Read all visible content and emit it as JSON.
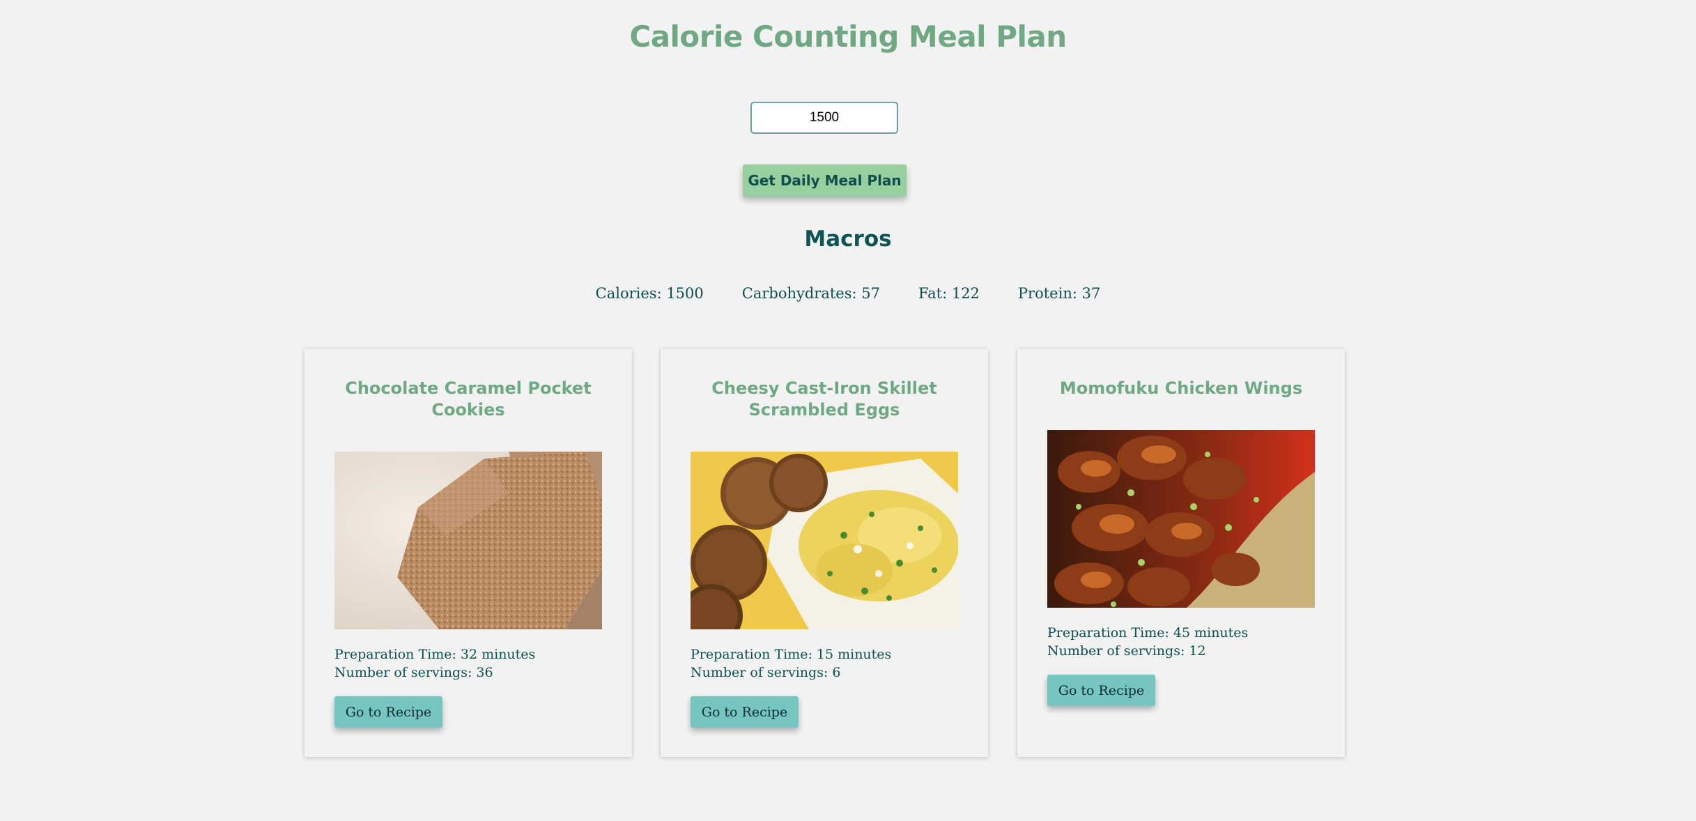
{
  "page": {
    "title": "Calorie Counting Meal Plan"
  },
  "form": {
    "calorie_value": "1500",
    "button_label": "Get Daily Meal Plan"
  },
  "macros": {
    "heading": "Macros",
    "calories": "Calories: 1500",
    "carbohydrates": "Carbohydrates: 57",
    "fat": "Fat: 122",
    "protein": "Protein: 37"
  },
  "meals": [
    {
      "title": "Chocolate Caramel Pocket Cookies",
      "prep_time": "Preparation Time: 32 minutes",
      "servings": "Number of servings: 36",
      "button_label": "Go to Recipe",
      "image_icon": "cookie-bars-photo"
    },
    {
      "title": "Cheesy Cast-Iron Skillet Scrambled Eggs",
      "prep_time": "Preparation Time: 15 minutes",
      "servings": "Number of servings: 6",
      "button_label": "Go to Recipe",
      "image_icon": "scrambled-eggs-photo"
    },
    {
      "title": "Momofuku Chicken Wings",
      "prep_time": "Preparation Time: 45 minutes",
      "servings": "Number of servings: 12",
      "button_label": "Go to Recipe",
      "image_icon": "chicken-wings-photo"
    }
  ],
  "colors": {
    "background": "#f2f2f2",
    "title_green": "#6fa883",
    "dark_teal": "#0f4e4e",
    "primary_button": "#98cf9e",
    "recipe_button": "#76c5c2"
  }
}
